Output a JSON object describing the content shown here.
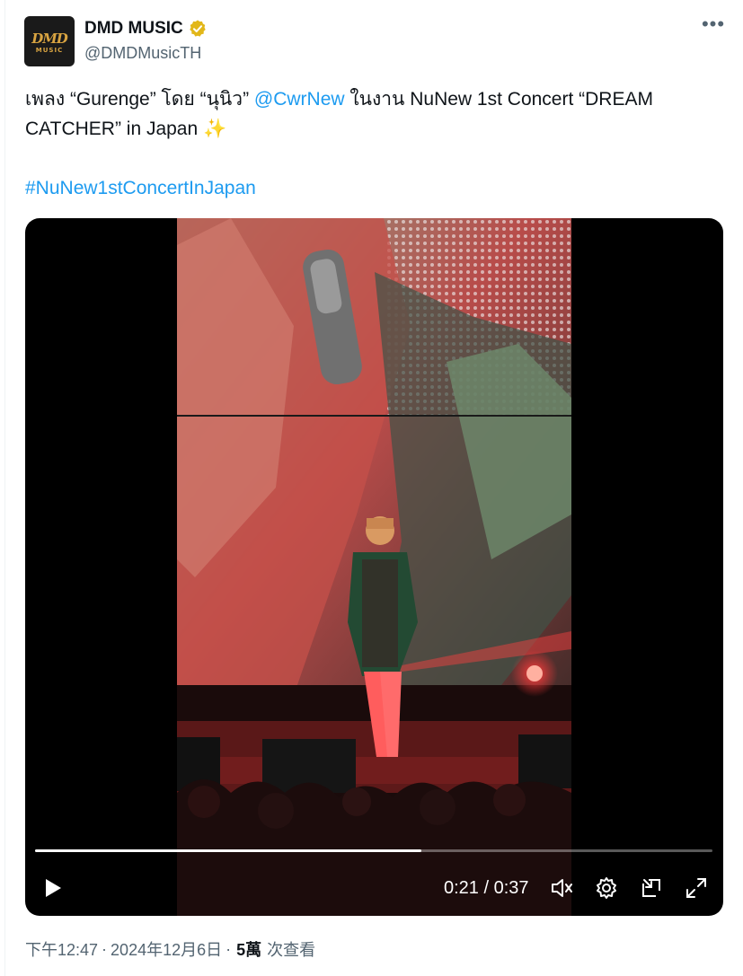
{
  "account": {
    "display_name": "DMD MUSIC",
    "handle": "@DMDMusicTH",
    "avatar_logo": "DMD",
    "avatar_sub": "MUSIC",
    "verified_color": "#e2b719"
  },
  "more_icon": "more-horizontal-icon",
  "tweet": {
    "text_part1": "เพลง “Gurenge” โดย “นุนิว” ",
    "mention": "@CwrNew",
    "text_part2": " ในงาน NuNew 1st Concert “DREAM CATCHER” in Japan ",
    "sparkle": "✨",
    "hashtag": "#NuNew1stConcertInJapan"
  },
  "video": {
    "current_time": "0:21",
    "separator": "/",
    "duration": "0:37",
    "progress_fraction": 0.57,
    "controls": [
      "play-icon",
      "volume-icon",
      "settings-icon",
      "pop-out-icon",
      "fullscreen-icon"
    ]
  },
  "footer": {
    "time": "下午12:47",
    "dot1": "·",
    "date": "2024年12月6日",
    "dot2": "·",
    "views_count": "5萬",
    "views_label": "次查看"
  },
  "colors": {
    "link": "#1d9bf0",
    "secondary_text": "#536471",
    "primary_text": "#0f1419"
  }
}
